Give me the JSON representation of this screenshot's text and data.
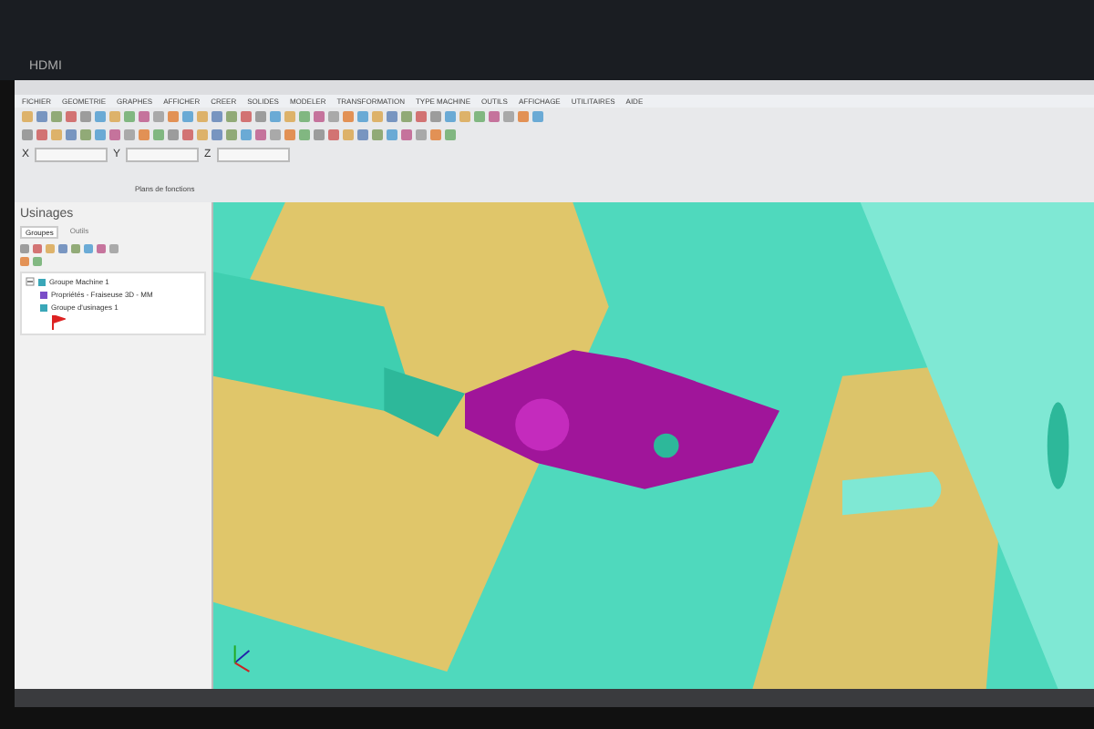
{
  "monitor": {
    "brand": "HDMI"
  },
  "menu": [
    "FICHIER",
    "GEOMETRIE",
    "GRAPHES",
    "AFFICHER",
    "CREER",
    "SOLIDES",
    "MODELER",
    "TRANSFORMATION",
    "TYPE MACHINE",
    "OUTILS",
    "AFFICHAGE",
    "UTILITAIRES",
    "AIDE"
  ],
  "coordinates": [
    {
      "axis": "X"
    },
    {
      "axis": "Y"
    },
    {
      "axis": "Z"
    }
  ],
  "plane_label": "Plans de fonctions",
  "panel": {
    "title": "Usinages",
    "tabs": [
      {
        "label": "Groupes",
        "selected": true
      },
      {
        "label": "Outils",
        "selected": false
      }
    ],
    "tree": [
      {
        "label": "Groupe Machine 1",
        "expanded": true,
        "children": [
          {
            "label": "Propriétés - Fraiseuse 3D - MM"
          },
          {
            "label": "Groupe d'usinages 1"
          }
        ]
      }
    ]
  }
}
